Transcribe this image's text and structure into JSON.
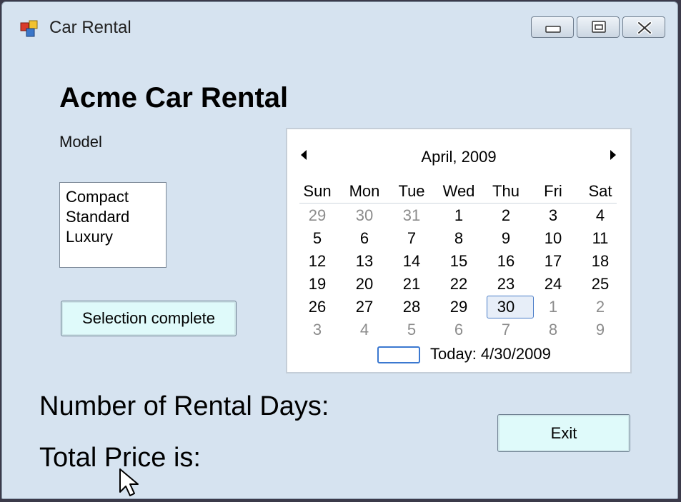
{
  "window": {
    "title": "Car Rental",
    "controls": [
      "minimize-icon",
      "maximize-icon",
      "close-icon"
    ]
  },
  "form": {
    "heading": "Acme Car Rental",
    "model_label": "Model",
    "models": [
      "Compact",
      "Standard",
      "Luxury"
    ],
    "selection_button": "Selection complete",
    "rental_days_label": "Number of Rental Days:",
    "total_price_label": "Total Price is:",
    "exit_button": "Exit"
  },
  "calendar": {
    "month_label": "April, 2009",
    "weekdays": [
      "Sun",
      "Mon",
      "Tue",
      "Wed",
      "Thu",
      "Fri",
      "Sat"
    ],
    "weeks": [
      [
        "29",
        "30",
        "31",
        "1",
        "2",
        "3",
        "4"
      ],
      [
        "5",
        "6",
        "7",
        "8",
        "9",
        "10",
        "11"
      ],
      [
        "12",
        "13",
        "14",
        "15",
        "16",
        "17",
        "18"
      ],
      [
        "19",
        "20",
        "21",
        "22",
        "23",
        "24",
        "25"
      ],
      [
        "26",
        "27",
        "28",
        "29",
        "30",
        "1",
        "2"
      ],
      [
        "3",
        "4",
        "5",
        "6",
        "7",
        "8",
        "9"
      ]
    ],
    "selected_day": "30",
    "today_label": "Today: 4/30/2009"
  },
  "colors": {
    "window_bg": "#d6e3f0",
    "button_bg": "#dffafa",
    "selection_border": "#4a7dc8"
  }
}
